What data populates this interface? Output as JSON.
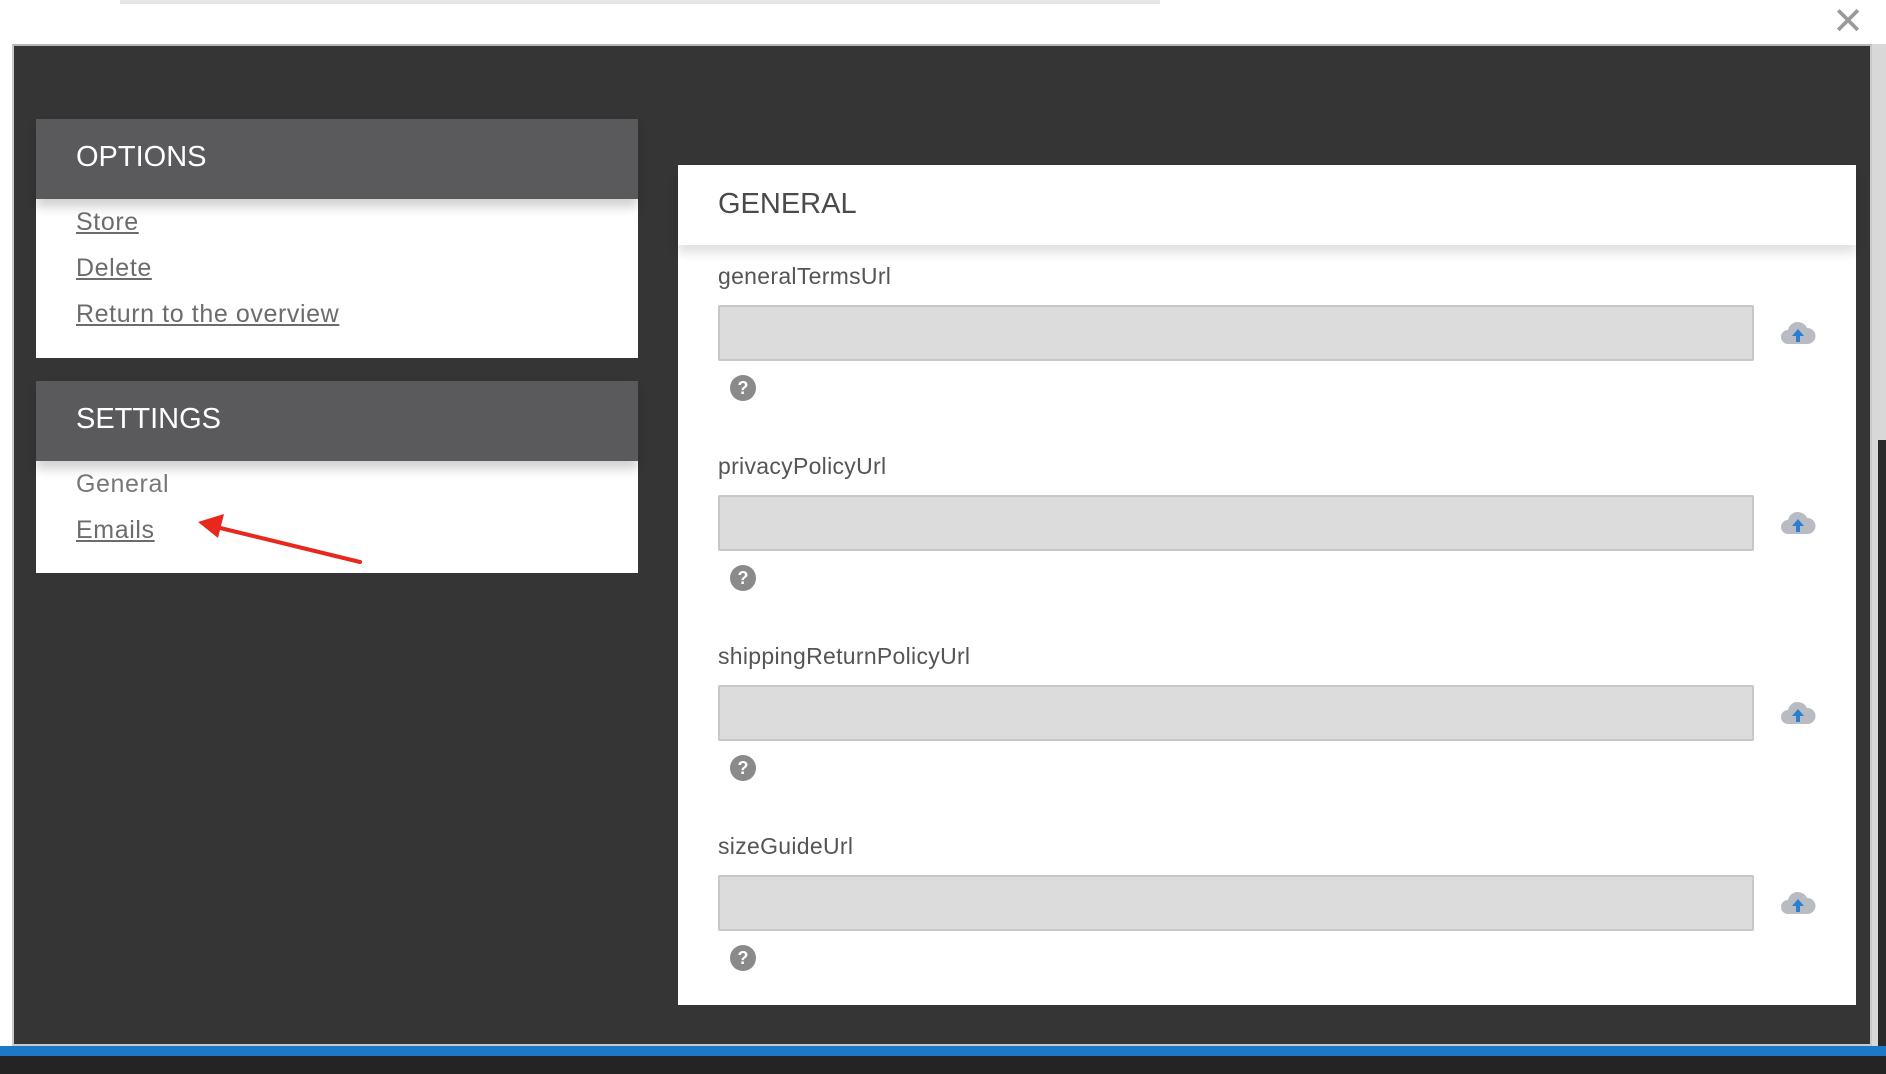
{
  "window": {
    "close_glyph": "✕"
  },
  "options": {
    "title": "OPTIONS",
    "links": [
      "Store",
      "Delete",
      "Return to the overview"
    ]
  },
  "settings": {
    "title": "SETTINGS",
    "links": [
      "General",
      "Emails"
    ]
  },
  "main": {
    "title": "GENERAL",
    "fields": [
      {
        "label": "generalTermsUrl",
        "value": "",
        "help_glyph": "?"
      },
      {
        "label": "privacyPolicyUrl",
        "value": "",
        "help_glyph": "?"
      },
      {
        "label": "shippingReturnPolicyUrl",
        "value": "",
        "help_glyph": "?"
      },
      {
        "label": "sizeGuideUrl",
        "value": "",
        "help_glyph": "?"
      }
    ]
  },
  "icons": {
    "close": "close-icon",
    "upload": "cloud-upload-icon",
    "help": "help-icon",
    "annotation": "red-arrow"
  },
  "colors": {
    "dialog_bg": "#353535",
    "panel_header": "#5a5a5c",
    "input_bg": "#dcdcdc",
    "arrow": "#e8281c",
    "cloud": "#b8bcc2",
    "cloud_arrow": "#2a7fd0",
    "bottom_bar": "#1e78c8"
  }
}
